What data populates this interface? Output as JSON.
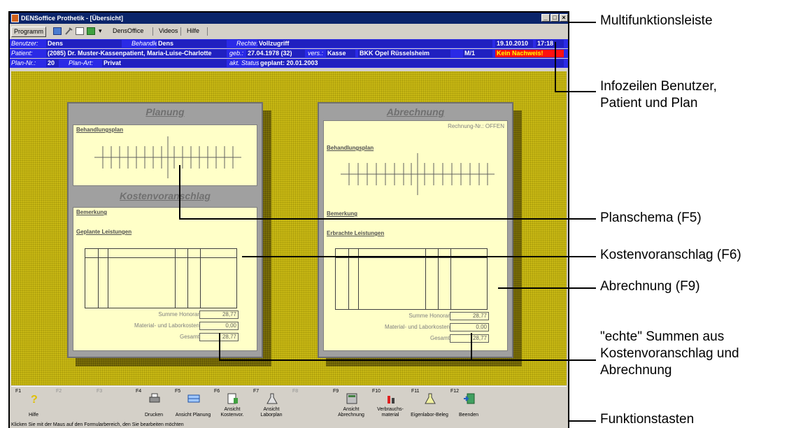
{
  "window": {
    "title": "DENSoffice Prothetik - [Übersicht]",
    "buttons": [
      "_",
      "□",
      "×"
    ]
  },
  "menubar": {
    "program": "Programm",
    "dropdown": "▾",
    "items": [
      "DensOffice",
      "Videos",
      "Hilfe"
    ]
  },
  "info": {
    "benutzer_label": "Benutzer:",
    "benutzer": "Dens",
    "behandler_label": "Behandler:",
    "behandler": "Dens",
    "rechte_label": "Rechte:",
    "rechte": "Vollzugriff",
    "date": "19.10.2010",
    "time": "17:18",
    "patient_label": "Patient:",
    "patient": "(2085) Dr. Muster-Kassenpatient, Maria-Luise-Charlotte",
    "geb_label": "geb.:",
    "geb": "27.04.1978 (32)",
    "vers_label": "vers.:",
    "vers": "Kasse",
    "kasse": "BKK Opel Rüsselsheim",
    "status_code": "M/1",
    "nachweis": "Kein Nachweis!",
    "plannr_label": "Plan-Nr.:",
    "plannr": "20",
    "planart_label": "Plan-Art:",
    "planart": "Privat",
    "akt_status_label": "akt. Status:",
    "akt_status": "geplant: 20.01.2003"
  },
  "planung": {
    "title": "Planung",
    "behandlungsplan": "Behandlungsplan",
    "kostenvoranschlag": "Kostenvoranschlag",
    "bemerkung": "Bemerkung",
    "leistungen": "Geplante Leistungen",
    "sums": [
      {
        "label": "Summe Honorar",
        "value": "28,77"
      },
      {
        "label": "Material- und Laborkosten",
        "value": "0,00"
      },
      {
        "label": "Gesamt",
        "value": "28,77"
      }
    ]
  },
  "abrechnung": {
    "title": "Abrechnung",
    "rechnung": "Rechnung-Nr.: OFFEN",
    "behandlungsplan": "Behandlungsplan",
    "bemerkung": "Bemerkung",
    "leistungen": "Erbrachte Leistungen",
    "sums": [
      {
        "label": "Summe Honorar",
        "value": "28,77"
      },
      {
        "label": "Material- und Laborkosten",
        "value": "0,00"
      },
      {
        "label": "Gesamt",
        "value": "28,77"
      }
    ]
  },
  "fkeys": [
    {
      "key": "F1",
      "label": "Hilfe",
      "icon": "question-icon",
      "enabled": true
    },
    {
      "key": "F2",
      "label": "",
      "icon": "",
      "enabled": false
    },
    {
      "key": "F3",
      "label": "",
      "icon": "",
      "enabled": false
    },
    {
      "key": "F4",
      "label": "Drucken",
      "icon": "printer-icon",
      "enabled": true
    },
    {
      "key": "F5",
      "label": "Ansicht Planung",
      "icon": "teeth-scheme-icon",
      "enabled": true
    },
    {
      "key": "F6",
      "label": "Ansicht Kostenvor.",
      "icon": "cost-estimate-icon",
      "enabled": true
    },
    {
      "key": "F7",
      "label": "Ansicht Laborplan",
      "icon": "flask-icon",
      "enabled": true
    },
    {
      "key": "F8",
      "label": "",
      "icon": "",
      "enabled": false
    },
    {
      "key": "F9",
      "label": "Ansicht Abrechnung",
      "icon": "calculator-icon",
      "enabled": true
    },
    {
      "key": "F10",
      "label": "Verbrauchs-material",
      "icon": "material-icon",
      "enabled": true
    },
    {
      "key": "F11",
      "label": "Eigenlabor-Beleg",
      "icon": "lab-flask-icon",
      "enabled": true
    },
    {
      "key": "F12",
      "label": "Beenden",
      "icon": "exit-door-icon",
      "enabled": true
    }
  ],
  "statusbar": "Klicken Sie mit der Maus auf den Formularbereich, den Sie bearbeiten möchten",
  "annotations": {
    "multifunktion": "Multifunktionsleiste",
    "infozeilen_1": "Infozeilen Benutzer,",
    "infozeilen_2": "Patient und Plan",
    "planschema": "Planschema (F5)",
    "kostenvoranschlag": "Kostenvoranschlag (F6)",
    "abrechnung": "Abrechnung (F9)",
    "summen_1": "\"echte\" Summen aus",
    "summen_2": "Kostenvoranschlag und",
    "summen_3": "Abrechnung",
    "funktionstasten": "Funktionstasten"
  }
}
